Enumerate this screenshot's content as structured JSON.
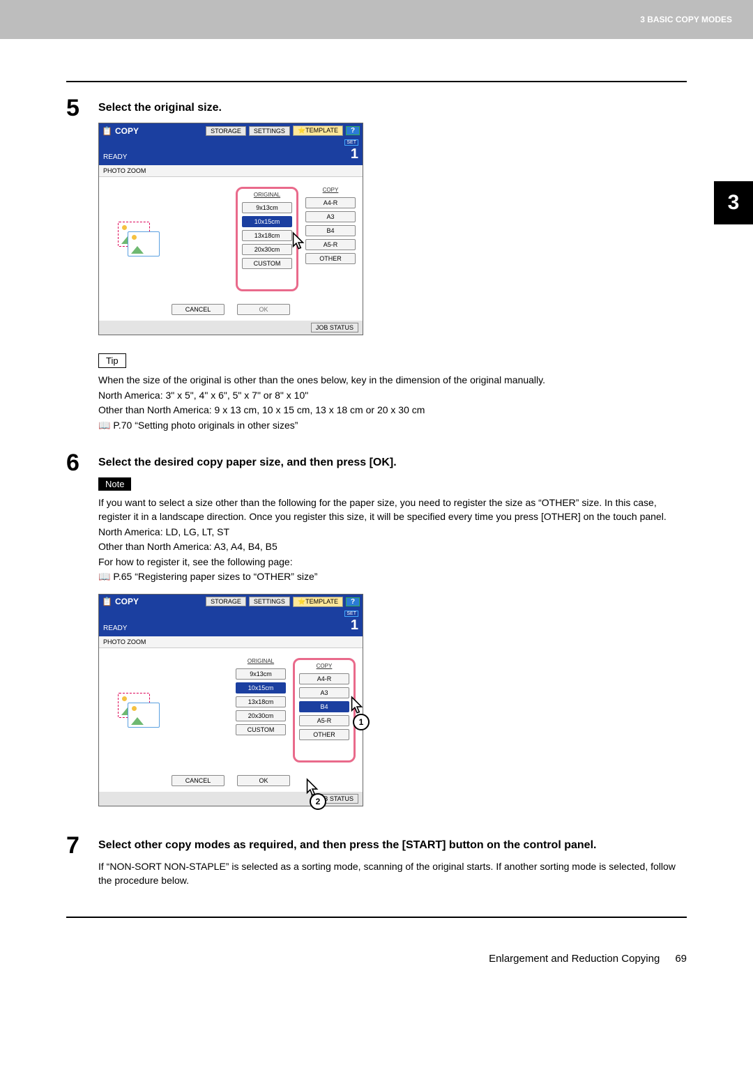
{
  "header": {
    "chapter_label": "3 BASIC COPY MODES",
    "chapter_tab": "3"
  },
  "footer": {
    "section": "Enlargement and Reduction Copying",
    "page": "69"
  },
  "step5": {
    "num": "5",
    "title": "Select the original size.",
    "tip_label": "Tip",
    "tip_lines": [
      "When the size of the original is other than the ones below, key in the dimension of the original manually.",
      "North America: 3\" x 5\", 4\" x 6\", 5\" x 7\" or 8\" x 10\"",
      "Other than North America: 9 x 13 cm, 10 x 15 cm, 13 x 18 cm or 20 x 30 cm"
    ],
    "tip_ref": "P.70 “Setting photo originals in other sizes”"
  },
  "step6": {
    "num": "6",
    "title": "Select the desired copy paper size, and then press [OK].",
    "note_label": "Note",
    "note_lines": [
      "If you want to select a size other than the following for the paper size, you need to register the size as “OTHER” size. In this case, register it in a landscape direction. Once you register this size, it will be specified every time you press [OTHER] on the touch panel.",
      "North America: LD, LG, LT, ST",
      "Other than North America: A3, A4, B4, B5",
      "For how to register it, see the following page:"
    ],
    "note_ref": "P.65 “Registering paper sizes to “OTHER” size”"
  },
  "step7": {
    "num": "7",
    "title": "Select other copy modes as required, and then press the [START] button on the control panel.",
    "body": "If “NON-SORT NON-STAPLE” is selected as a sorting mode, scanning of the original starts. If another sorting mode is selected, follow the procedure below."
  },
  "device": {
    "app": "COPY",
    "top_buttons": {
      "storage": "STORAGE",
      "settings": "SETTINGS",
      "template": "TEMPLATE",
      "help": "?"
    },
    "status": "READY",
    "set_label": "SET",
    "count": "1",
    "mode": "PHOTO ZOOM",
    "columns": {
      "original": "ORIGINAL",
      "copy": "COPY"
    },
    "original_sizes": [
      "9x13cm",
      "10x15cm",
      "13x18cm",
      "20x30cm",
      "CUSTOM"
    ],
    "copy_sizes": [
      "A4-R",
      "A3",
      "B4",
      "A5-R",
      "OTHER"
    ],
    "actions": {
      "cancel": "CANCEL",
      "ok": "OK"
    },
    "jobstatus": "JOB STATUS",
    "screenA": {
      "highlight": "original",
      "original_selected": "10x15cm",
      "copy_selected": null,
      "ok_active": false
    },
    "screenB": {
      "highlight": "copy",
      "original_selected": "10x15cm",
      "copy_selected": "B4",
      "ok_active": true,
      "callout1": "1",
      "callout2": "2"
    }
  }
}
